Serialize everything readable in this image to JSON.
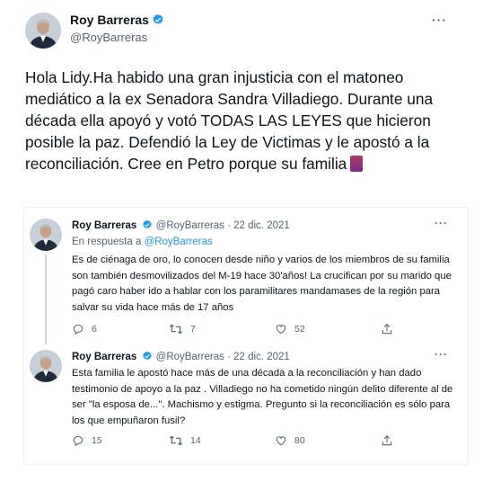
{
  "main_tweet": {
    "author_name": "Roy Barreras",
    "author_handle": "@RoyBarreras",
    "more": "···",
    "text": "Hola Lidy.Ha habido una gran injusticia con el matoneo mediático a la ex Senadora Sandra Villadiego. Durante una década ella apoyó y votó TODAS LAS LEYES que hicieron posible la paz. Defendió la Ley de Victimas y le apostó a la reconciliación. Cree en Petro porque su familia"
  },
  "thread": [
    {
      "author_name": "Roy Barreras",
      "author_handle": "@RoyBarreras",
      "separator": "·",
      "date": "22 dic. 2021",
      "more": "···",
      "in_reply_prefix": "En respuesta a",
      "in_reply_handle": "@RoyBarreras",
      "text": "Es de ciénaga de oro, lo conocen desde niño y varios de los miembros de su familia son también desmovilizados del M-19 hace 30'años! La crucifican por su marido que pagó caro haber ido a hablar con los paramilitares mandamases de la región para salvar su vida hace más de 17 años",
      "replies": "6",
      "retweets": "7",
      "likes": "52"
    },
    {
      "author_name": "Roy Barreras",
      "author_handle": "@RoyBarreras",
      "separator": "·",
      "date": "22 dic. 2021",
      "more": "···",
      "text": "Esta familia le apostó hace más de una década a la reconciliación y han dado testimonio de apoyo a la paz . Villadiego no ha cometido ningún delito diferente al de ser \"la esposa de...\". Machismo y estigma. Pregunto si la reconciliación es sólo para los que empuñaron fusil?",
      "replies": "15",
      "retweets": "14",
      "likes": "80"
    }
  ],
  "colors": {
    "verified": "#1d9bf0",
    "secondary_text": "#536471",
    "link": "#1d9bf0"
  },
  "icons": [
    "verified-badge-icon",
    "more-icon",
    "reply-icon",
    "retweet-icon",
    "like-icon",
    "share-icon",
    "scroll-emoji-icon"
  ]
}
